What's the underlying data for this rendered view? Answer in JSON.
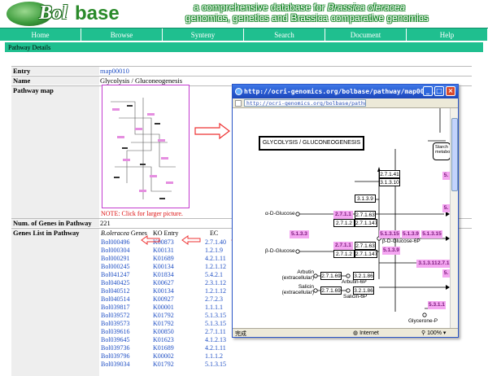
{
  "header": {
    "logo_bol": "Bol",
    "logo_base": "base",
    "tagline_pre": "a comprehensive database for ",
    "tagline_species": "Brassica oleracea",
    "tagline_line2": "genomics, genetics and Brassica comparative genomics"
  },
  "nav": [
    "Home",
    "Browse",
    "Synteny",
    "Search",
    "Document",
    "Help"
  ],
  "section_title": "Pathway Details",
  "details": {
    "entry_label": "Entry",
    "entry_value": "map00010",
    "name_label": "Name",
    "name_value": "Glycolysis / Gluconeogenesis",
    "map_label": "Pathway map",
    "map_note": "NOTE: Click for larger picture.",
    "num_label": "Num. of Genes in Pathway",
    "num_value": "221",
    "genes_label": "Genes List in Pathway"
  },
  "genes_table": {
    "header_species": "B.oleracea",
    "header_genes": " Genes",
    "header_ko": "KO Entry",
    "header_ec": "EC",
    "rows": [
      [
        "Bol000496",
        "K00873",
        "2.7.1.40"
      ],
      [
        "Bol000304",
        "K00131",
        "1.2.1.9"
      ],
      [
        "Bol000291",
        "K01689",
        "4.2.1.11"
      ],
      [
        "Bol000245",
        "K00134",
        "1.2.1.12"
      ],
      [
        "Bol041247",
        "K01834",
        "5.4.2.1"
      ],
      [
        "Bol040425",
        "K00627",
        "2.3.1.12"
      ],
      [
        "Bol040512",
        "K00134",
        "1.2.1.12"
      ],
      [
        "Bol040514",
        "K00927",
        "2.7.2.3"
      ],
      [
        "Bol039817",
        "K00001",
        "1.1.1.1"
      ],
      [
        "Bol039572",
        "K01792",
        "5.1.3.15"
      ],
      [
        "Bol039573",
        "K01792",
        "5.1.3.15"
      ],
      [
        "Bol039616",
        "K00850",
        "2.7.1.11"
      ],
      [
        "Bol039645",
        "K01623",
        "4.1.2.13"
      ],
      [
        "Bol039736",
        "K01689",
        "4.2.1.11"
      ],
      [
        "Bol039796",
        "K00002",
        "1.1.1.2"
      ],
      [
        "Bol039034",
        "K01792",
        "5.1.3.15"
      ]
    ]
  },
  "popup": {
    "title": "http://ocri-genomics.org/bolbase/pathway/map0001...",
    "address": "http://ocri-genomics.org/bolbase/pathway/map00010.png",
    "map_title": "GLYCOLYSIS / GLUCONEOGENESIS",
    "starch_label": "Starch",
    "starch_label2": "metabo",
    "enzymes_plain": [
      "2.7.1.41",
      "3.1.3.10",
      "3.1.3.9",
      "2.7.1.63",
      "2.7.1.2",
      "2.7.1.147",
      "2.7.1.63",
      "2.7.1.2",
      "2.7.1.147",
      "2.7.1.69",
      "3.2.1.86",
      "2.7.1.69",
      "3.2.1.86"
    ],
    "enzymes_pink": [
      "5.1.3.3",
      "2.7.1.1",
      "2.7.1.1",
      "5.1.3.15",
      "5.1.3.9",
      "5.1.3.9",
      "5.1.3.15",
      "3.1.3.11",
      "2.7.1.1",
      "5.3.1.1",
      "5.",
      "5.",
      "5."
    ],
    "compounds": [
      "α-D-Glucose",
      "β-D-Glucose",
      "β-D-Glucose-6P",
      "Arbutin (extracellular)",
      "Arbutin-6P",
      "Salicin (extracellular)",
      "Salicin-6P",
      "Glycerone-P"
    ],
    "status_done": "完成",
    "status_zone": "Internet",
    "status_zoom": "100%"
  },
  "colors": {
    "nav_bg": "#1fbf8f",
    "link": "#1f4fc4",
    "note_red": "#dd1111",
    "enzyme_pink": "#f4a6f1",
    "titlebar_blue": "#2657cf"
  }
}
